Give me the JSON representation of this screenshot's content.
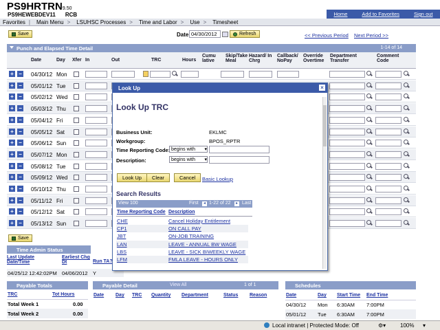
{
  "header": {
    "app_title": "PS9HRTRN",
    "version": "9.50",
    "server": "PS9HEWEBDEV11",
    "user": "RCB",
    "links": [
      "Home",
      "Add to Favorites",
      "Sign out"
    ]
  },
  "nav": {
    "items": [
      "Favorites",
      "Main Menu",
      "LSUHSC Processes",
      "Time and Labor",
      "Use",
      "Timesheet"
    ]
  },
  "toolbar": {
    "save_label": "Save",
    "date_label": "Date:",
    "date_value": "04/30/2012",
    "refresh_label": "Refresh",
    "prev_period": "<< Previous Period",
    "next_period": "Next Period >>"
  },
  "punch": {
    "title": "Punch and Elapsed Time Detail",
    "range": "1-14 of 14",
    "columns": [
      "Date",
      "Day",
      "Xfer",
      "In",
      "Out",
      "TRC",
      "Hours",
      "Cumu lative",
      "Skip/Take Meal",
      "Hazard/ In Chrg",
      "Callback/ NoPay",
      "Override Overtime",
      "Department Transfer",
      "Comment Code"
    ],
    "rows": [
      {
        "date": "04/30/12",
        "day": "Mon"
      },
      {
        "date": "05/01/12",
        "day": "Tue"
      },
      {
        "date": "05/02/12",
        "day": "Wed"
      },
      {
        "date": "05/03/12",
        "day": "Thu"
      },
      {
        "date": "05/04/12",
        "day": "Fri"
      },
      {
        "date": "05/05/12",
        "day": "Sat"
      },
      {
        "date": "05/06/12",
        "day": "Sun"
      },
      {
        "date": "05/07/12",
        "day": "Mon"
      },
      {
        "date": "05/08/12",
        "day": "Tue"
      },
      {
        "date": "05/09/12",
        "day": "Wed"
      },
      {
        "date": "05/10/12",
        "day": "Thu"
      },
      {
        "date": "05/11/12",
        "day": "Fri"
      },
      {
        "date": "05/12/12",
        "day": "Sat"
      },
      {
        "date": "05/13/12",
        "day": "Sun"
      }
    ]
  },
  "admin": {
    "title": "Time Admin Status",
    "col1": "Last Update Date/Time",
    "col2": "Earliest Chg Dt",
    "col3": "Run TA?",
    "val1": "04/25/12 12:42:02PM",
    "val2": "04/06/2012",
    "val3": "Y"
  },
  "payable_totals": {
    "title": "Payable Totals",
    "col1": "TRC",
    "col2": "Tot Hours",
    "rows": [
      {
        "label": "Total Week 1",
        "value": "0.00"
      },
      {
        "label": "Total Week 2",
        "value": "0.00"
      }
    ]
  },
  "payable_detail": {
    "title": "Payable Detail",
    "view_all": "View All",
    "range": "1 of 1",
    "columns": [
      "Date",
      "Day",
      "TRC",
      "Quantity",
      "Department",
      "Status",
      "Reason"
    ]
  },
  "schedules": {
    "title": "Schedules",
    "columns": [
      "Date",
      "Day",
      "Start Time",
      "End Time"
    ],
    "rows": [
      {
        "date": "04/30/12",
        "day": "Mon",
        "start": "6:30AM",
        "end": "7:00PM"
      },
      {
        "date": "05/01/12",
        "day": "Tue",
        "start": "6:30AM",
        "end": "7:00PM"
      }
    ]
  },
  "lookup": {
    "window_title": "Look Up",
    "heading": "Look Up TRC",
    "business_unit_label": "Business Unit:",
    "business_unit_value": "EKLMC",
    "workgroup_label": "Workgroup:",
    "workgroup_value": "BPOS_RPTR",
    "trc_label": "Time Reporting Code:",
    "trc_operator": "begins with",
    "desc_label": "Description:",
    "desc_operator": "begins with",
    "lookup_btn": "Look Up",
    "clear_btn": "Clear",
    "cancel_btn": "Cancel",
    "basic_lookup": "Basic Lookup",
    "results_title": "Search Results",
    "view_label": "View 100",
    "first_label": "First",
    "range": "1-22 of 22",
    "last_label": "Last",
    "col_code": "Time Reporting Code",
    "col_desc": "Description",
    "results": [
      {
        "code": "CHE",
        "desc": "Cancel Holiday Entitlement"
      },
      {
        "code": "CP1",
        "desc": "ON CALL PAY"
      },
      {
        "code": "JBT",
        "desc": "ON-JOB TRAINING"
      },
      {
        "code": "LAN",
        "desc": "LEAVE - ANNUAL BW WAGE"
      },
      {
        "code": "LBS",
        "desc": "LEAVE - SICK BIWEEKLY WAGE"
      },
      {
        "code": "LFM",
        "desc": "FMLA LEAVE - HOURS ONLY"
      }
    ]
  },
  "status_bar": {
    "zone": "Local intranet | Protected Mode: Off",
    "zoom": "100%"
  }
}
